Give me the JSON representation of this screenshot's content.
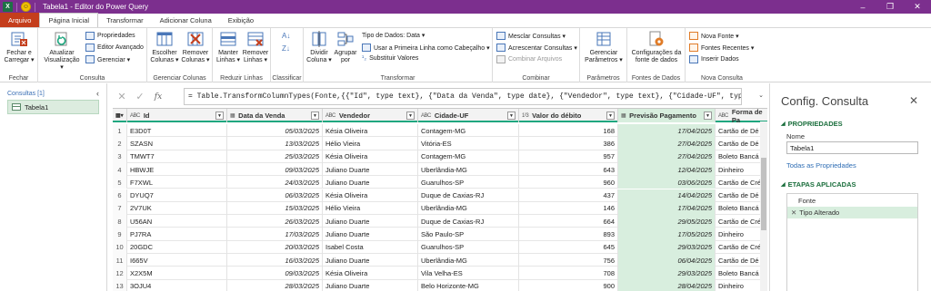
{
  "titlebar": {
    "app_icon": "X",
    "title": "Tabela1 - Editor do Power Query",
    "controls": [
      "–",
      "❐",
      "✕"
    ]
  },
  "tabs": [
    {
      "label": "Arquivo"
    },
    {
      "label": "Página Inicial"
    },
    {
      "label": "Transformar"
    },
    {
      "label": "Adicionar Coluna"
    },
    {
      "label": "Exibição"
    }
  ],
  "ribbon": {
    "groups": {
      "fechar": "Fechar",
      "consulta": "Consulta",
      "gerenciar_colunas": "Gerenciar Colunas",
      "reduzir_linhas": "Reduzir Linhas",
      "classificar": "Classificar",
      "transformar": "Transformar",
      "combinar": "Combinar",
      "parametros": "Parâmetros",
      "fontes_dados": "Fontes de Dados",
      "nova_consulta": "Nova Consulta"
    },
    "buttons": {
      "fechar_carregar_1": "Fechar e",
      "fechar_carregar_2": "Carregar ▾",
      "atualizar_1": "Atualizar",
      "atualizar_2": "Visualização ▾",
      "propriedades": "Propriedades",
      "editor_avancado": "Editor Avançado",
      "gerenciar": "Gerenciar ▾",
      "escolher_1": "Escolher",
      "escolher_2": "Colunas ▾",
      "remover_col_1": "Remover",
      "remover_col_2": "Colunas ▾",
      "manter_1": "Manter",
      "manter_2": "Linhas ▾",
      "remover_lin_1": "Remover",
      "remover_lin_2": "Linhas ▾",
      "dividir_1": "Dividir",
      "dividir_2": "Coluna ▾",
      "agrupar_1": "Agrupar",
      "agrupar_2": "por",
      "tipo_dados": "Tipo de Dados: Data ▾",
      "primeira_linha": "Usar a Primeira Linha como Cabeçalho ▾",
      "substituir": "Substituir Valores",
      "mesclar": "Mesclar Consultas ▾",
      "acrescentar": "Acrescentar Consultas ▾",
      "combinar_arquivos": "Combinar Arquivos",
      "gerenciar_param_1": "Gerenciar",
      "gerenciar_param_2": "Parâmetros ▾",
      "config_fonte_1": "Configurações da",
      "config_fonte_2": "fonte de dados",
      "nova_fonte": "Nova Fonte ▾",
      "fontes_recentes": "Fontes Recentes ▾",
      "inserir_dados": "Inserir Dados"
    }
  },
  "queries": {
    "header": "Consultas [1]",
    "items": [
      "Tabela1"
    ]
  },
  "formula": {
    "text": "= Table.TransformColumnTypes(Fonte,{{\"Id\", type text}, {\"Data da Venda\", type date}, {\"Vendedor\", type text}, {\"Cidade-UF\", type text},"
  },
  "grid": {
    "columns": [
      {
        "type": "ABC",
        "name": "Id"
      },
      {
        "type": "▦",
        "name": "Data da Venda"
      },
      {
        "type": "ABC",
        "name": "Vendedor"
      },
      {
        "type": "ABC",
        "name": "Cidade-UF"
      },
      {
        "type": "1²3",
        "name": "Valor do débito"
      },
      {
        "type": "▦",
        "name": "Previsão Pagamento"
      },
      {
        "type": "ABC",
        "name": "Forma de Pa"
      }
    ],
    "rows": [
      [
        "1",
        "E3D0T",
        "05/03/2025",
        "Késia Oliveira",
        "Contagem-MG",
        "168",
        "17/04/2025",
        "Cartão de Dé"
      ],
      [
        "2",
        "SZASN",
        "13/03/2025",
        "Hélio Vieira",
        "Vitória-ES",
        "386",
        "27/04/2025",
        "Cartão de Dé"
      ],
      [
        "3",
        "TMWT7",
        "25/03/2025",
        "Késia Oliveira",
        "Contagem-MG",
        "957",
        "27/04/2025",
        "Boleto Bancá"
      ],
      [
        "4",
        "HBWJE",
        "09/03/2025",
        "Juliano Duarte",
        "Uberlândia-MG",
        "643",
        "12/04/2025",
        "Dinheiro"
      ],
      [
        "5",
        "F7XWL",
        "24/03/2025",
        "Juliano Duarte",
        "Guarulhos-SP",
        "960",
        "03/06/2025",
        "Cartão de Cré"
      ],
      [
        "6",
        "DYUQ7",
        "06/03/2025",
        "Késia Oliveira",
        "Duque de Caxias-RJ",
        "437",
        "14/04/2025",
        "Cartão de Dé"
      ],
      [
        "7",
        "2V7UK",
        "15/03/2025",
        "Hélio Vieira",
        "Uberlândia-MG",
        "146",
        "17/04/2025",
        "Boleto Bancá"
      ],
      [
        "8",
        "U56AN",
        "26/03/2025",
        "Juliano Duarte",
        "Duque de Caxias-RJ",
        "664",
        "29/05/2025",
        "Cartão de Cré"
      ],
      [
        "9",
        "PJ7RA",
        "17/03/2025",
        "Juliano Duarte",
        "São Paulo-SP",
        "893",
        "17/05/2025",
        "Dinheiro"
      ],
      [
        "10",
        "20GDC",
        "20/03/2025",
        "Isabel Costa",
        "Guarulhos-SP",
        "645",
        "29/03/2025",
        "Cartão de Cré"
      ],
      [
        "11",
        "I665V",
        "16/03/2025",
        "Juliano Duarte",
        "Uberlândia-MG",
        "756",
        "06/04/2025",
        "Cartão de Dé"
      ],
      [
        "12",
        "X2X5M",
        "09/03/2025",
        "Késia Oliveira",
        "Vila Velha-ES",
        "708",
        "29/03/2025",
        "Boleto Bancá"
      ],
      [
        "13",
        "3OJU4",
        "28/03/2025",
        "Juliano Duarte",
        "Belo Horizonte-MG",
        "900",
        "28/04/2025",
        "Dinheiro"
      ]
    ]
  },
  "settings": {
    "title": "Config. Consulta",
    "propriedades_header": "PROPRIEDADES",
    "nome_label": "Nome",
    "nome_value": "Tabela1",
    "todas_props": "Todas as Propriedades",
    "etapas_header": "ETAPAS APLICADAS",
    "steps": [
      "Fonte",
      "Tipo Alterado"
    ]
  },
  "colors": {
    "titlebar": "#7c2f8e",
    "file_tab": "#c43e1c",
    "accent_green": "#1fa77f",
    "selection_green": "#d8eede"
  }
}
